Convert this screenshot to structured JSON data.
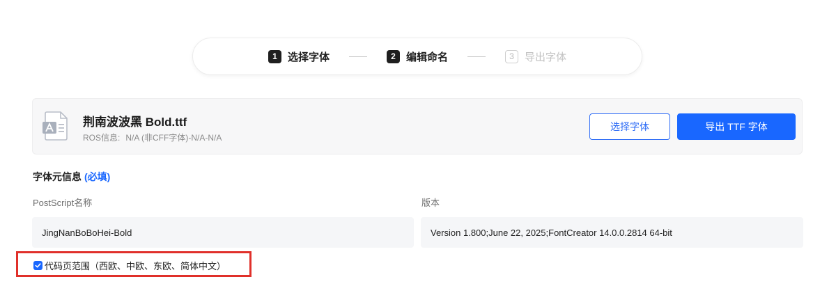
{
  "stepper": {
    "steps": [
      {
        "num": "1",
        "label": "选择字体",
        "state": "active"
      },
      {
        "num": "2",
        "label": "编辑命名",
        "state": "active"
      },
      {
        "num": "3",
        "label": "导出字体",
        "state": "inactive"
      }
    ]
  },
  "file": {
    "icon": "font-file-icon",
    "name": "荆南波波黑 Bold.ttf",
    "ros_label": "ROS信息:",
    "ros_value": "N/A (非CFF字体)-N/A-N/A",
    "select_button": "选择字体",
    "export_button": "导出 TTF 字体"
  },
  "meta": {
    "title": "字体元信息",
    "required": "(必填)",
    "postscript": {
      "label": "PostScript名称",
      "value": "JingNanBoBoHei-Bold"
    },
    "version": {
      "label": "版本",
      "value": "Version 1.800;June 22, 2025;FontCreator 14.0.0.2814 64-bit"
    }
  },
  "codepage": {
    "checked": true,
    "label": "代码页范围（西欧、中欧、东欧、简体中文）"
  },
  "colors": {
    "accent": "#1967ff",
    "highlight": "#e0302a"
  }
}
